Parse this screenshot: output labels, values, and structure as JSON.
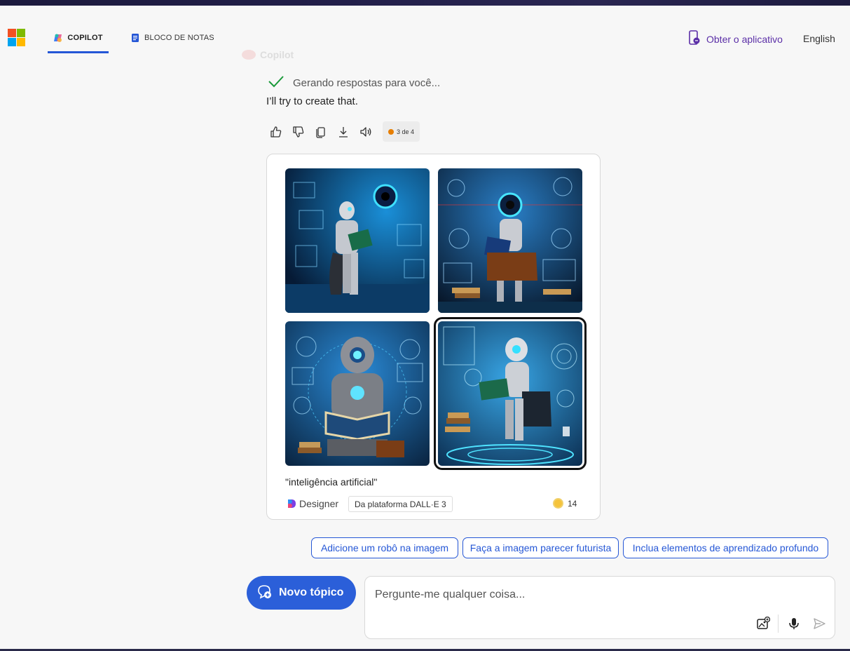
{
  "header": {
    "tabs": [
      {
        "label": "COPILOT",
        "active": true,
        "icon": "copilot-icon"
      },
      {
        "label": "BLOCO DE NOTAS",
        "active": false,
        "icon": "notebook-icon"
      }
    ],
    "get_app_label": "Obter o aplicativo",
    "language_label": "English"
  },
  "message": {
    "author": "Copilot",
    "status_text": "Gerando respostas para você...",
    "reply_text": "I’ll try to create that.",
    "counter_text": "3 de 4",
    "actions": [
      "thumbs-up-icon",
      "thumbs-down-icon",
      "copy-icon",
      "download-icon",
      "speaker-icon"
    ]
  },
  "image_card": {
    "images": [
      {
        "label": "generated-image-1",
        "selected": false
      },
      {
        "label": "generated-image-2",
        "selected": false
      },
      {
        "label": "generated-image-3",
        "selected": false
      },
      {
        "label": "generated-image-4",
        "selected": true
      }
    ],
    "caption": "\"inteligência artificial\"",
    "designer_label": "Designer",
    "platform_label": "Da plataforma DALL·E 3",
    "boost_count": "14"
  },
  "suggestions": [
    "Adicione um robô na imagem",
    "Faça a imagem parecer futurista",
    "Inclua elementos de aprendizado profundo"
  ],
  "composer": {
    "new_topic_label": "Novo tópico",
    "placeholder": "Pergunte-me qualquer coisa..."
  },
  "colors": {
    "accent": "#2557d6",
    "brand_purple": "#5b2fa7",
    "new_topic_bg": "#2b5fd9"
  }
}
